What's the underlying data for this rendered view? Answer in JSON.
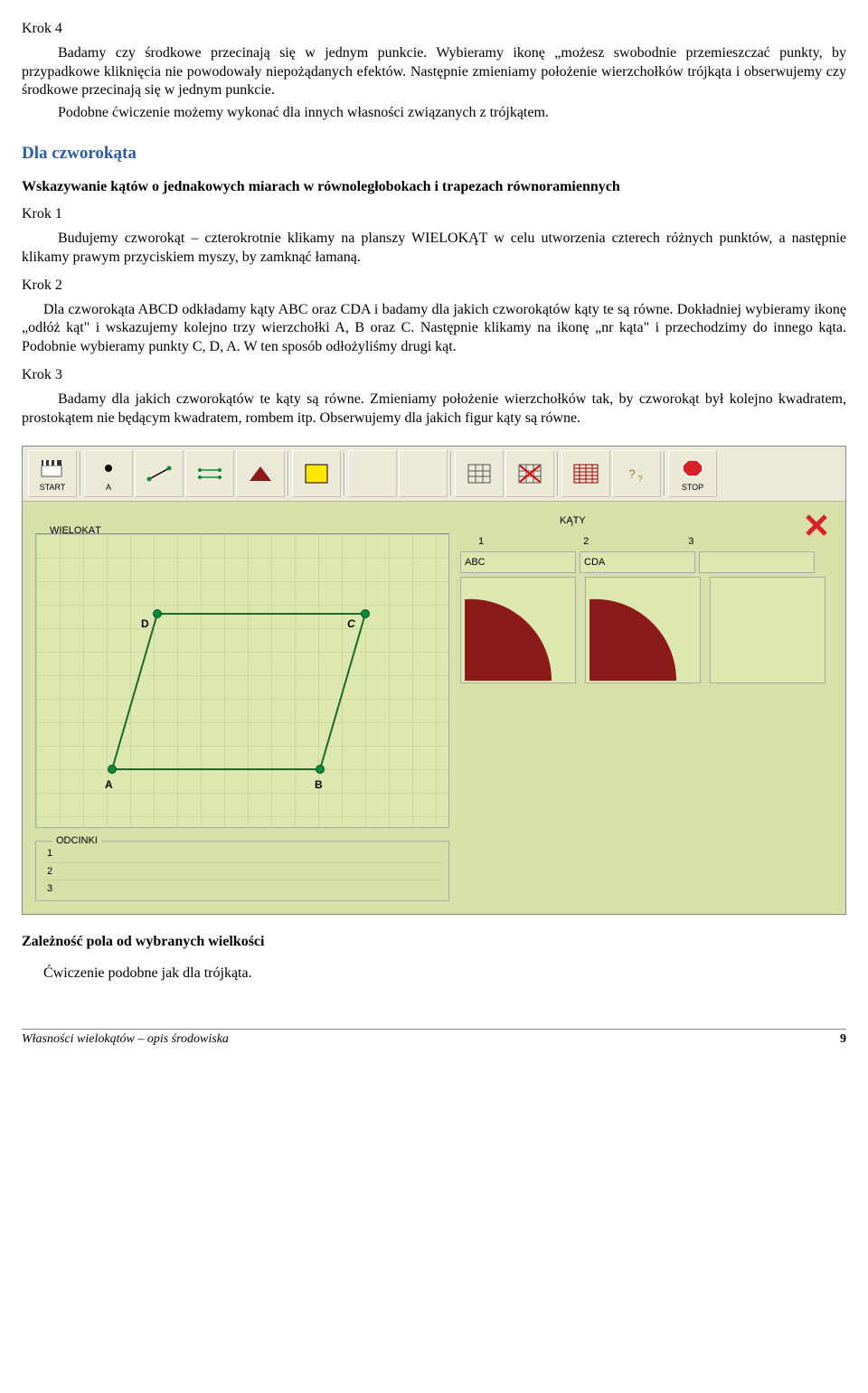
{
  "krok4": {
    "heading": "Krok 4",
    "p1": "Badamy czy środkowe przecinają się w jednym punkcie. Wybieramy ikonę „możesz swobodnie przemieszczać punkty, by przypadkowe kliknięcia nie powodowały niepożądanych efektów. Następnie zmieniamy położenie wierzchołków trójkąta i obserwujemy czy środkowe przecinają się w jednym punkcie.",
    "p2": "Podobne ćwiczenie możemy wykonać dla innych własności związanych z trójkątem."
  },
  "section": {
    "title": "Dla czworokąta",
    "subheading": "Wskazywanie kątów o jednakowych miarach w równoległobokach i trapezach równoramiennych"
  },
  "krok1": {
    "heading": "Krok 1",
    "p": "Budujemy czworokąt – czterokrotnie klikamy na planszy WIELOKĄT w celu utworzenia czterech różnych punktów, a następnie klikamy prawym przyciskiem myszy, by zamknąć łamaną."
  },
  "krok2": {
    "heading": "Krok 2",
    "p": "Dla czworokąta ABCD odkładamy kąty ABC oraz CDA i badamy dla jakich czworokątów kąty te są równe. Dokładniej wybieramy ikonę „odłóż kąt\" i  wskazujemy kolejno trzy wierzchołki A, B oraz C. Następnie klikamy na ikonę „nr kąta\" i przechodzimy do innego kąta. Podobnie wybieramy punkty C, D, A. W ten sposób odłożyliśmy drugi kąt."
  },
  "krok3": {
    "heading": "Krok 3",
    "p": "Badamy dla jakich czworokątów te kąty są równe. Zmieniamy położenie wierzchołków tak, by czworokąt był kolejno kwadratem, prostokątem nie będącym kwadratem, rombem itp. Obserwujemy dla jakich figur kąty są równe."
  },
  "app": {
    "toolbar": {
      "start": "START",
      "point_label": "A",
      "stop": "STOP"
    },
    "panel_label": "WIELOKĄT",
    "angles": {
      "title": "KĄTY",
      "cols": [
        "1",
        "2",
        "3"
      ],
      "names": [
        "ABC",
        "CDA"
      ]
    },
    "vertices": {
      "A": "A",
      "B": "B",
      "C": "C",
      "D": "D"
    },
    "odcinki": {
      "title": "ODCINKI",
      "rows": [
        "1",
        "2",
        "3"
      ]
    }
  },
  "tail": {
    "heading": "Zależność pola od wybranych wielkości",
    "p": "Ćwiczenie podobne jak dla trójkąta."
  },
  "footer": {
    "left": "Własności wielokątów – opis środowiska",
    "right": "9"
  }
}
